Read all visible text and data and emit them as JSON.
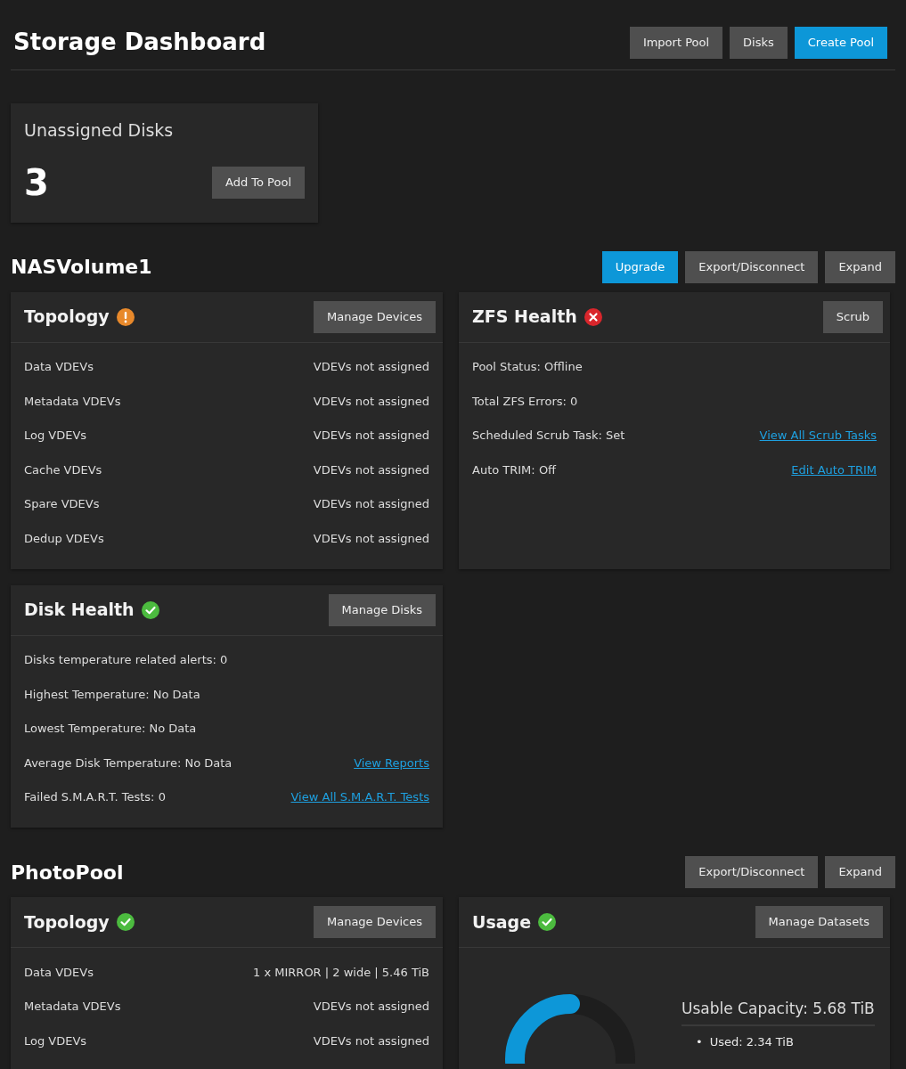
{
  "page": {
    "title": "Storage Dashboard",
    "buttons": [
      {
        "label": "Import Pool",
        "primary": false
      },
      {
        "label": "Disks",
        "primary": false
      },
      {
        "label": "Create Pool",
        "primary": true
      }
    ]
  },
  "unassigned": {
    "title": "Unassigned Disks",
    "count": "3",
    "button": "Add To Pool"
  },
  "pools": [
    {
      "name": "NASVolume1",
      "buttons": [
        {
          "label": "Upgrade",
          "primary": true
        },
        {
          "label": "Export/Disconnect",
          "primary": false
        },
        {
          "label": "Expand",
          "primary": false
        }
      ],
      "cards": [
        {
          "kind": "pairs",
          "title": "Topology",
          "status_icon": {
            "kind": "warning"
          },
          "button": "Manage Devices",
          "rows": [
            {
              "label": "Data VDEVs",
              "value": "VDEVs not assigned"
            },
            {
              "label": "Metadata VDEVs",
              "value": "VDEVs not assigned"
            },
            {
              "label": "Log VDEVs",
              "value": "VDEVs not assigned"
            },
            {
              "label": "Cache VDEVs",
              "value": "VDEVs not assigned"
            },
            {
              "label": "Spare VDEVs",
              "value": "VDEVs not assigned"
            },
            {
              "label": "Dedup VDEVs",
              "value": "VDEVs not assigned"
            }
          ]
        },
        {
          "kind": "facts",
          "title": "ZFS Health",
          "status_icon": {
            "kind": "error"
          },
          "button": "Scrub",
          "rows": [
            {
              "label": "Pool Status:",
              "value": "Offline"
            },
            {
              "label": "Total ZFS Errors:",
              "value": "0"
            },
            {
              "label": "Scheduled Scrub Task:",
              "value": "Set",
              "link": "View All Scrub Tasks"
            },
            {
              "label": "Auto TRIM:",
              "value": "Off",
              "link": "Edit Auto TRIM"
            }
          ]
        },
        {
          "kind": "facts",
          "title": "Disk Health",
          "status_icon": {
            "kind": "ok"
          },
          "button": "Manage Disks",
          "rows": [
            {
              "label": "Disks temperature related alerts:",
              "value": "0"
            },
            {
              "label": "Highest Temperature:",
              "value": "No Data"
            },
            {
              "label": "Lowest Temperature:",
              "value": "No Data"
            },
            {
              "label": "Average Disk Temperature:",
              "value": "No Data",
              "link": "View Reports"
            },
            {
              "label": "Failed S.M.A.R.T. Tests:",
              "value": "0",
              "link": "View All S.M.A.R.T. Tests"
            }
          ]
        }
      ]
    },
    {
      "name": "PhotoPool",
      "buttons": [
        {
          "label": "Export/Disconnect",
          "primary": false
        },
        {
          "label": "Expand",
          "primary": false
        }
      ],
      "cards": [
        {
          "kind": "pairs",
          "title": "Topology",
          "status_icon": {
            "kind": "ok"
          },
          "button": "Manage Devices",
          "rows": [
            {
              "label": "Data VDEVs",
              "value": "1 x MIRROR | 2 wide | 5.46 TiB"
            },
            {
              "label": "Metadata VDEVs",
              "value": "VDEVs not assigned"
            },
            {
              "label": "Log VDEVs",
              "value": "VDEVs not assigned"
            }
          ]
        },
        {
          "kind": "usage",
          "title": "Usage",
          "status_icon": {
            "kind": "ok"
          },
          "button": "Manage Datasets",
          "capacity": "Usable Capacity: 5.68 TiB",
          "items": [
            {
              "bullet": "•",
              "text": "Used: 2.34 TiB"
            }
          ]
        }
      ]
    }
  ]
}
